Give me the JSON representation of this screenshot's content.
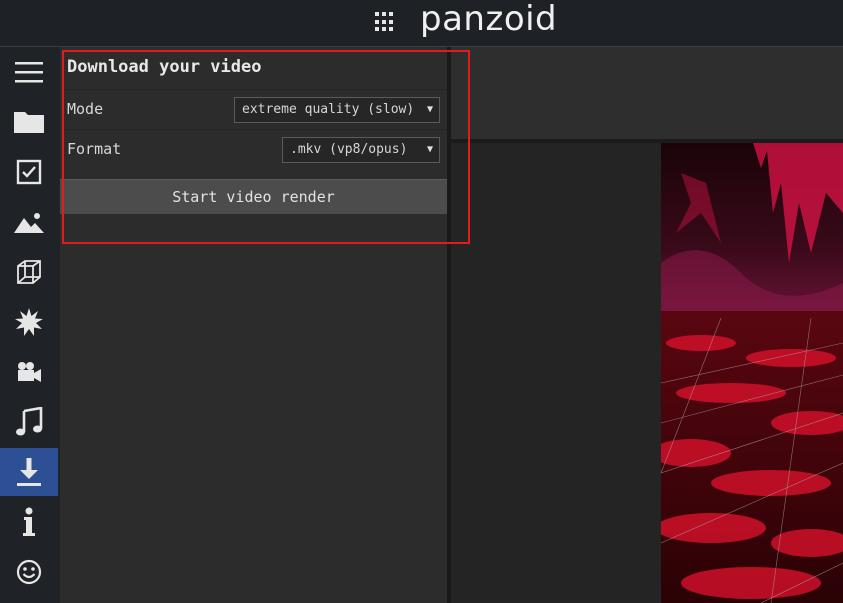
{
  "app": {
    "brand": "panzoid"
  },
  "nav": {
    "items": [
      {
        "name": "menu-icon"
      },
      {
        "name": "folder-icon"
      },
      {
        "name": "checkbox-icon"
      },
      {
        "name": "image-icon"
      },
      {
        "name": "cube-icon"
      },
      {
        "name": "burst-icon"
      },
      {
        "name": "camera-icon"
      },
      {
        "name": "music-icon"
      },
      {
        "name": "download-icon",
        "active": true
      },
      {
        "name": "info-icon"
      },
      {
        "name": "smiley-icon"
      }
    ],
    "active_color": "#2d4f93"
  },
  "panel": {
    "title": "Download your video",
    "mode": {
      "label": "Mode",
      "value": "extreme quality (slow)"
    },
    "format": {
      "label": "Format",
      "value": ".mkv (vp8/opus)"
    },
    "render_button": "Start video render"
  },
  "colors": {
    "highlight": "#e01c1c",
    "preview_red": "#c0102a"
  }
}
